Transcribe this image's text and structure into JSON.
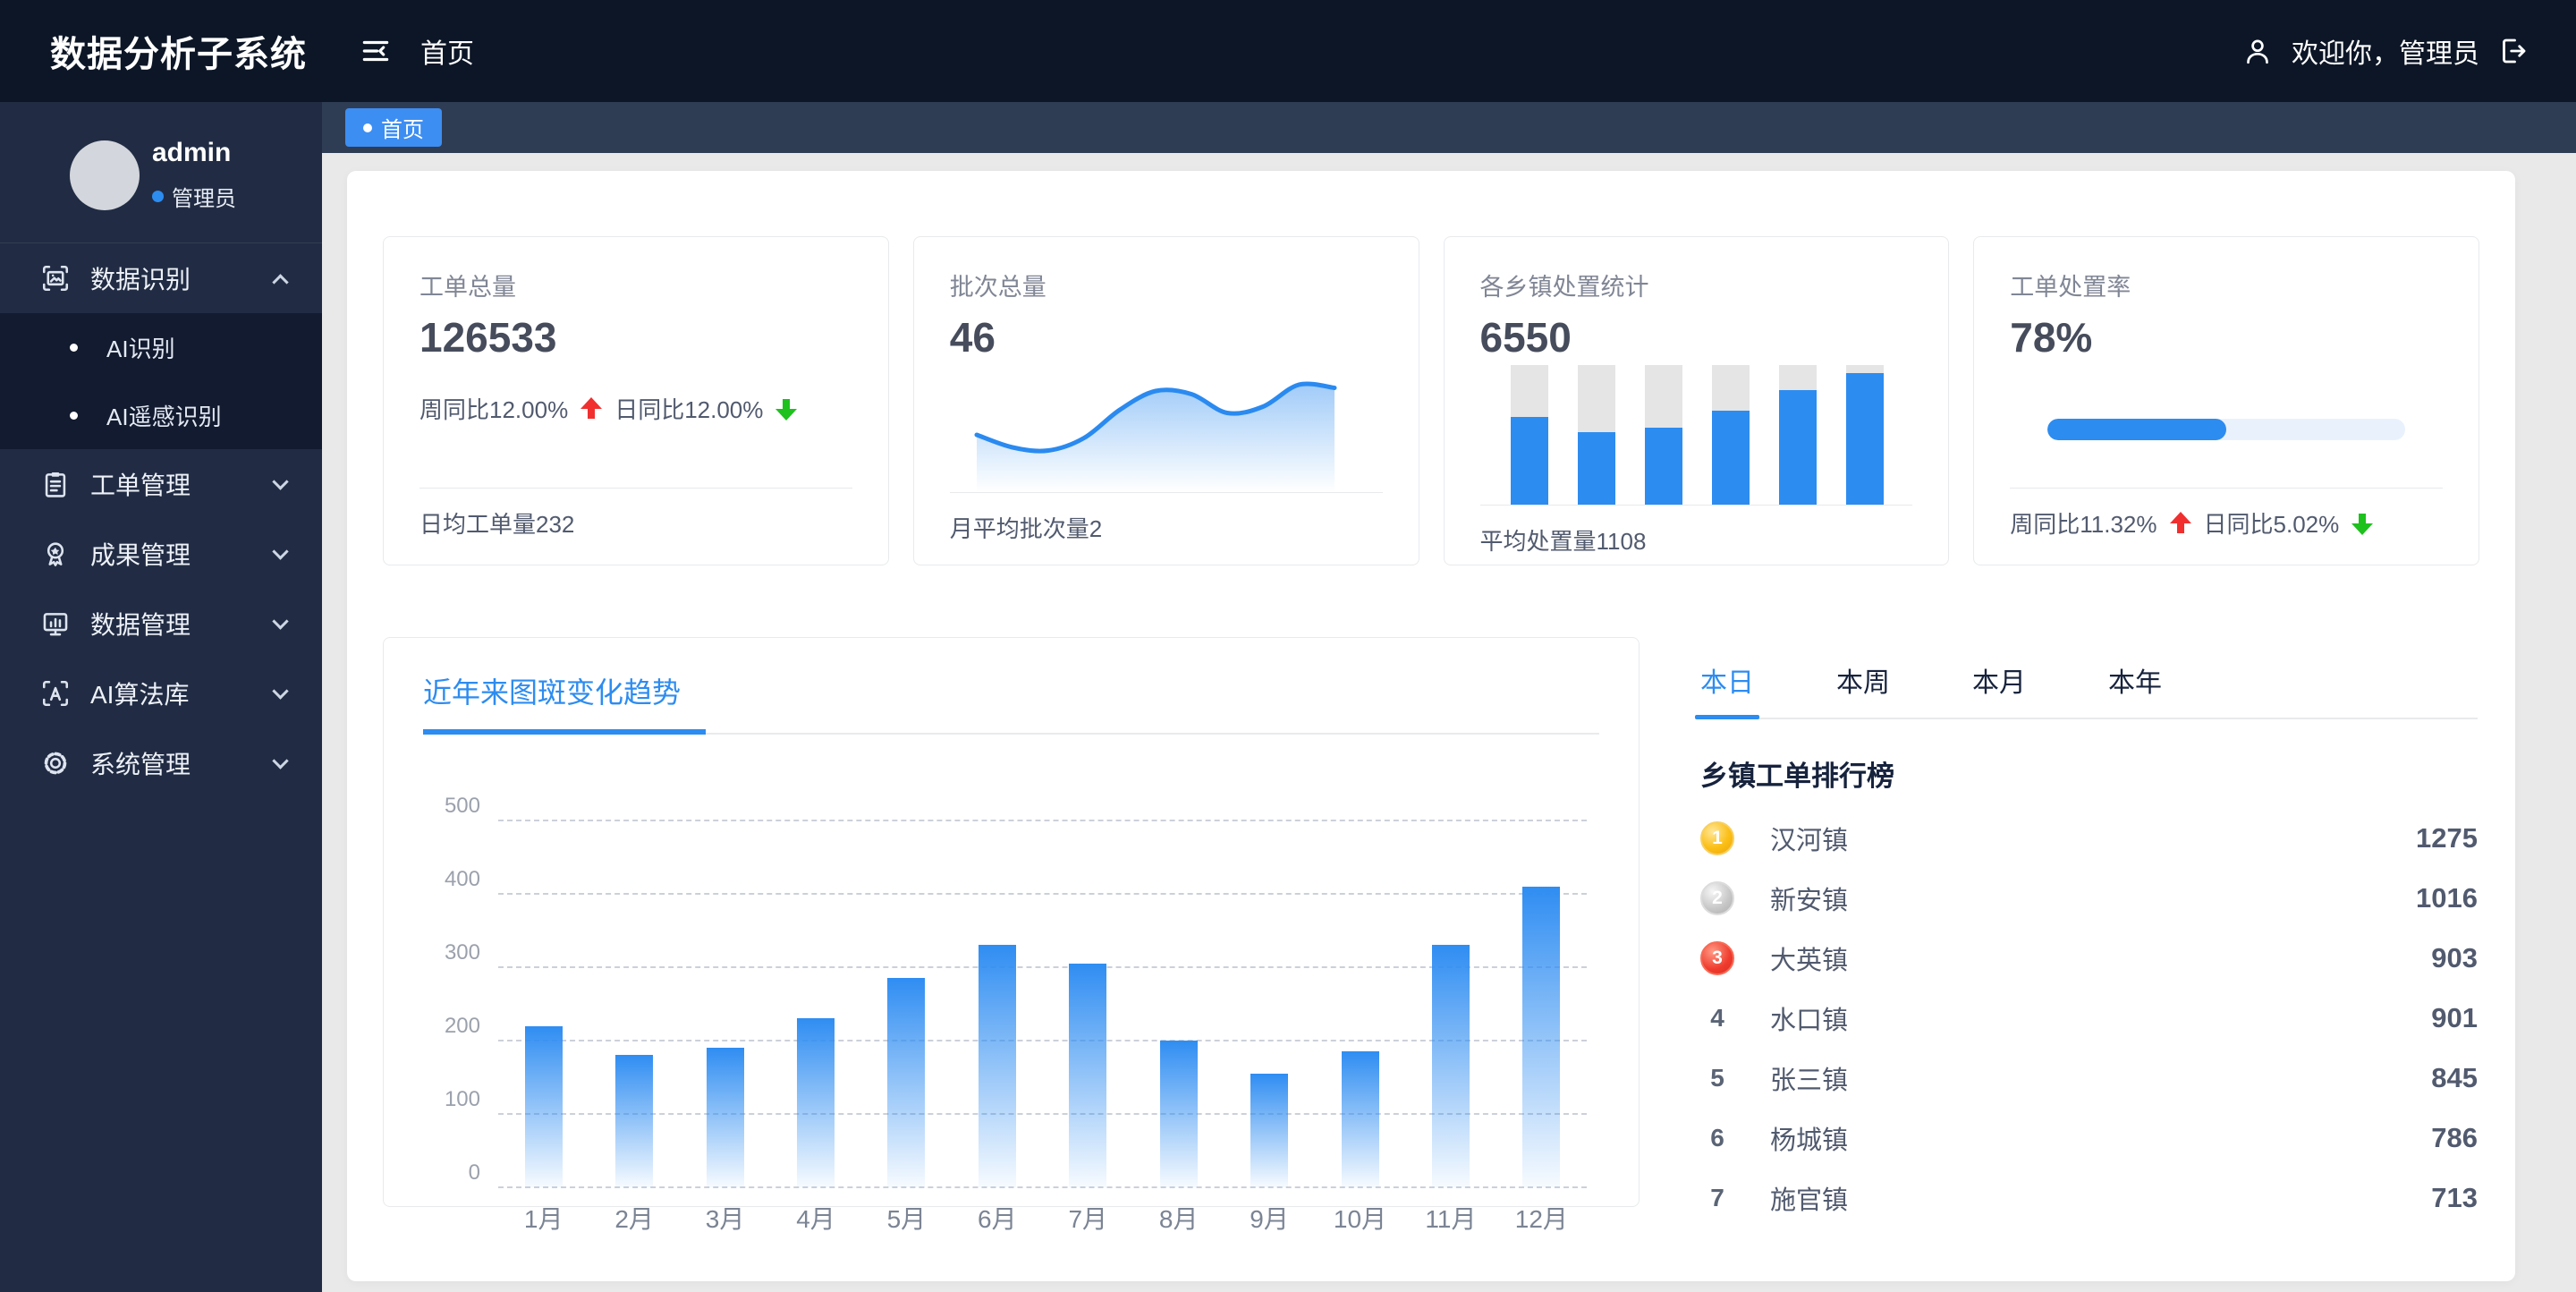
{
  "header": {
    "title": "数据分析子系统",
    "home": "首页",
    "welcome": "欢迎你，管理员"
  },
  "tabbar": {
    "active": "首页"
  },
  "sidebar": {
    "username": "admin",
    "role": "管理员",
    "menu": [
      {
        "label": "数据识别",
        "icon": "image-recognition-icon",
        "expanded": true,
        "children": [
          {
            "label": "AI识别"
          },
          {
            "label": "AI遥感识别"
          }
        ]
      },
      {
        "label": "工单管理",
        "icon": "clipboard-icon"
      },
      {
        "label": "成果管理",
        "icon": "medal-icon"
      },
      {
        "label": "数据管理",
        "icon": "data-monitor-icon"
      },
      {
        "label": "AI算法库",
        "icon": "ai-library-icon"
      },
      {
        "label": "系统管理",
        "icon": "gear-icon"
      }
    ]
  },
  "stats": {
    "card1": {
      "title": "工单总量",
      "value": "126533",
      "week": "周同比12.00%",
      "week_dir": "up",
      "day": "日同比12.00%",
      "day_dir": "down",
      "footer": "日均工单量232"
    },
    "card2": {
      "title": "批次总量",
      "value": "46",
      "footer": "月平均批次量2"
    },
    "card3": {
      "title": "各乡镇处置统计",
      "value": "6550",
      "footer": "平均处置量1108"
    },
    "card4": {
      "title": "工单处置率",
      "value": "78%",
      "week": "周同比11.32%",
      "week_dir": "up",
      "day": "日同比5.02%",
      "day_dir": "down",
      "progress_pct": 50
    }
  },
  "chart_data": [
    {
      "type": "bar",
      "title": "近年来图斑变化趋势",
      "categories": [
        "1月",
        "2月",
        "3月",
        "4月",
        "5月",
        "6月",
        "7月",
        "8月",
        "9月",
        "10月",
        "11月",
        "12月"
      ],
      "values": [
        220,
        180,
        190,
        230,
        285,
        330,
        305,
        200,
        155,
        185,
        330,
        410
      ],
      "xlabel": "",
      "ylabel": "",
      "ylim": [
        0,
        500
      ],
      "yticks": [
        0,
        100,
        200,
        300,
        400,
        500
      ],
      "grid": "dashed-horizontal",
      "bar_color": "#2d8cf0"
    },
    {
      "type": "area",
      "title": "批次总量趋势(迷你图)",
      "values": [
        32,
        24,
        22,
        30,
        48,
        60,
        58,
        46,
        50,
        64,
        62
      ],
      "color": "#2d8cf0",
      "legend": "none"
    },
    {
      "type": "bar",
      "title": "各乡镇处置统计(迷你图)",
      "values_percent": [
        63,
        52,
        55,
        67,
        82,
        94
      ],
      "track_color": "#e5e5e5",
      "fill_color": "#2d8cf0"
    }
  ],
  "ranking": {
    "tabs": [
      "本日",
      "本周",
      "本月",
      "本年"
    ],
    "active_tab": "本日",
    "title": "乡镇工单排行榜",
    "rows": [
      {
        "rank": 1,
        "name": "汉河镇",
        "value": "1275"
      },
      {
        "rank": 2,
        "name": "新安镇",
        "value": "1016"
      },
      {
        "rank": 3,
        "name": "大英镇",
        "value": "903"
      },
      {
        "rank": 4,
        "name": "水口镇",
        "value": "901"
      },
      {
        "rank": 5,
        "name": "张三镇",
        "value": "845"
      },
      {
        "rank": 6,
        "name": "杨城镇",
        "value": "786"
      },
      {
        "rank": 7,
        "name": "施官镇",
        "value": "713"
      }
    ]
  },
  "colors": {
    "accent": "#2d8cf0",
    "tab_active": "#3d8ef2",
    "header_bg": "#0c1626",
    "sidebar_bg": "#212c44",
    "up_red": "#f12f2f",
    "down_green": "#1ec11e",
    "gold": "#fbbf17",
    "silver": "#c6c6c6",
    "bronze_red": "#ef3b2d"
  }
}
